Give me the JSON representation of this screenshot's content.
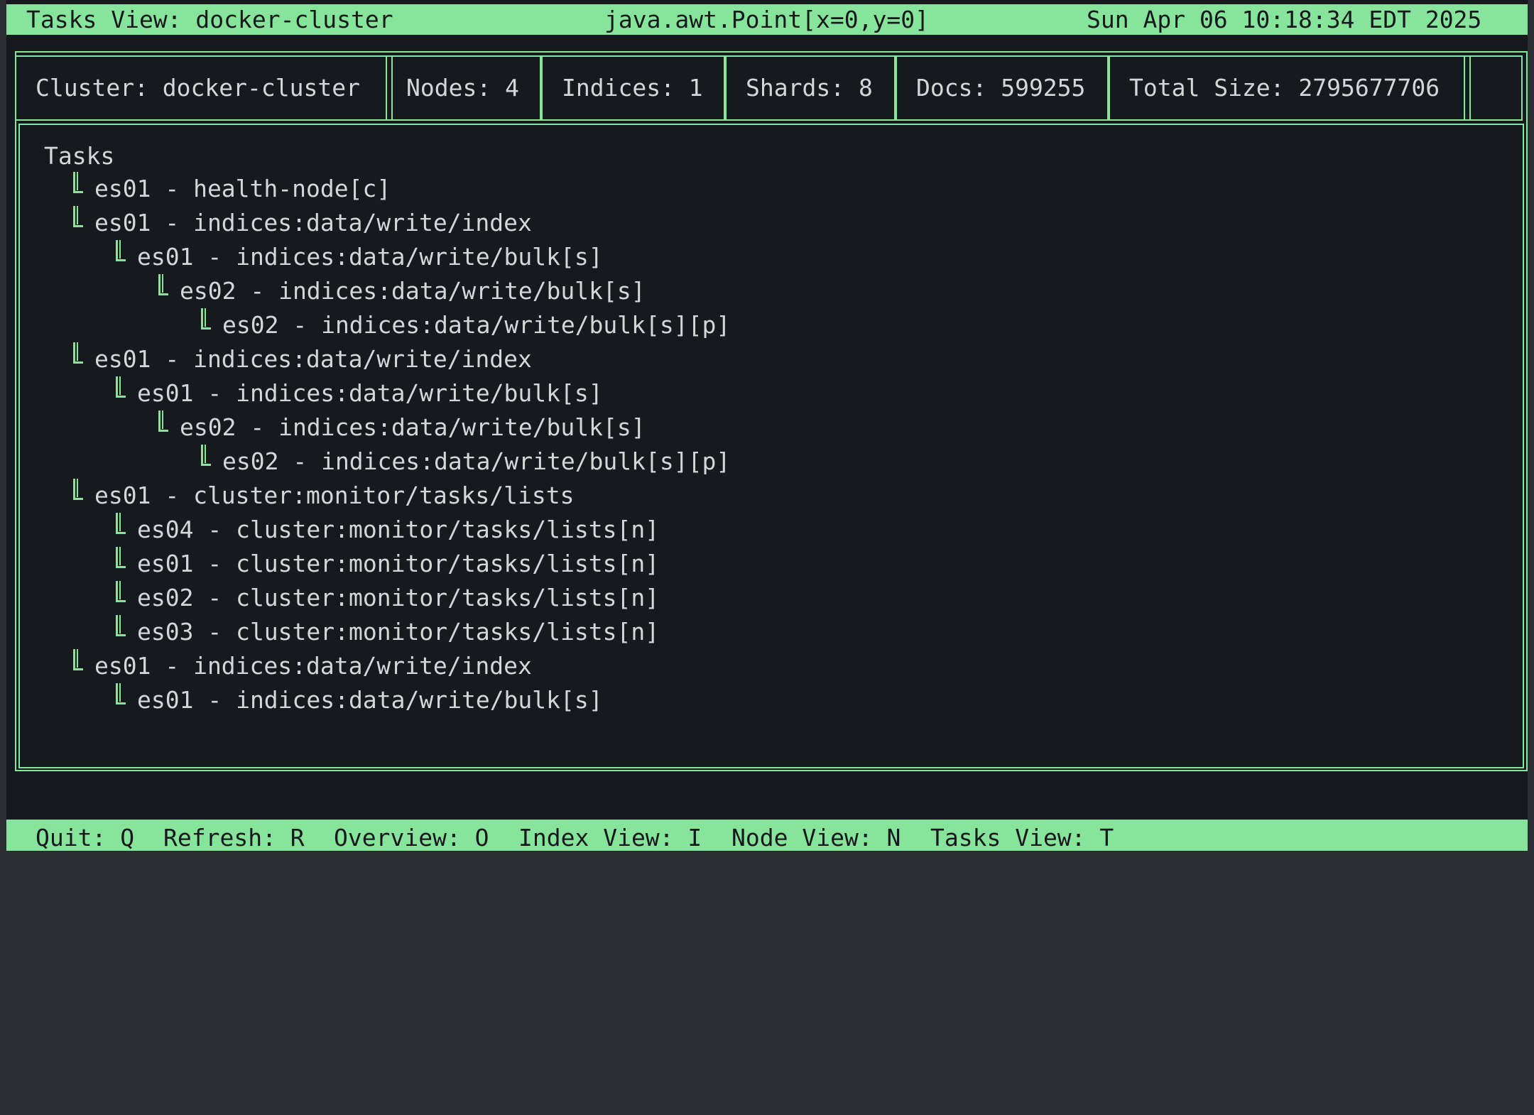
{
  "header": {
    "view_title": "Tasks View: docker-cluster",
    "cursor_point": "java.awt.Point[x=0,y=0]",
    "timestamp": "Sun Apr 06 10:18:34 EDT 2025"
  },
  "stats": {
    "cluster": "Cluster: docker-cluster",
    "nodes": "Nodes: 4",
    "indices": "Indices: 1",
    "shards": "Shards: 8",
    "docs": "Docs: 599255",
    "total_size": "Total Size: 2795677706"
  },
  "tasks": {
    "title": "Tasks",
    "items": [
      {
        "depth": 0,
        "label": "es01 - health-node[c]"
      },
      {
        "depth": 0,
        "label": "es01 - indices:data/write/index"
      },
      {
        "depth": 1,
        "label": "es01 - indices:data/write/bulk[s]"
      },
      {
        "depth": 2,
        "label": "es02 - indices:data/write/bulk[s]"
      },
      {
        "depth": 3,
        "label": "es02 - indices:data/write/bulk[s][p]"
      },
      {
        "depth": 0,
        "label": "es01 - indices:data/write/index"
      },
      {
        "depth": 1,
        "label": "es01 - indices:data/write/bulk[s]"
      },
      {
        "depth": 2,
        "label": "es02 - indices:data/write/bulk[s]"
      },
      {
        "depth": 3,
        "label": "es02 - indices:data/write/bulk[s][p]"
      },
      {
        "depth": 0,
        "label": "es01 - cluster:monitor/tasks/lists"
      },
      {
        "depth": 1,
        "label": "es04 - cluster:monitor/tasks/lists[n]"
      },
      {
        "depth": 1,
        "label": "es01 - cluster:monitor/tasks/lists[n]"
      },
      {
        "depth": 1,
        "label": "es02 - cluster:monitor/tasks/lists[n]"
      },
      {
        "depth": 1,
        "label": "es03 - cluster:monitor/tasks/lists[n]"
      },
      {
        "depth": 0,
        "label": "es01 - indices:data/write/index"
      },
      {
        "depth": 1,
        "label": "es01 - indices:data/write/bulk[s]"
      }
    ]
  },
  "footer": {
    "quit": "Quit: Q",
    "refresh": "Refresh: R",
    "overview": "Overview: O",
    "index_view": "Index View: I",
    "node_view": "Node View: N",
    "tasks_view": "Tasks View: T"
  },
  "colors": {
    "accent": "#86e59a",
    "background": "#161a1f",
    "text": "#d6d6d6"
  }
}
